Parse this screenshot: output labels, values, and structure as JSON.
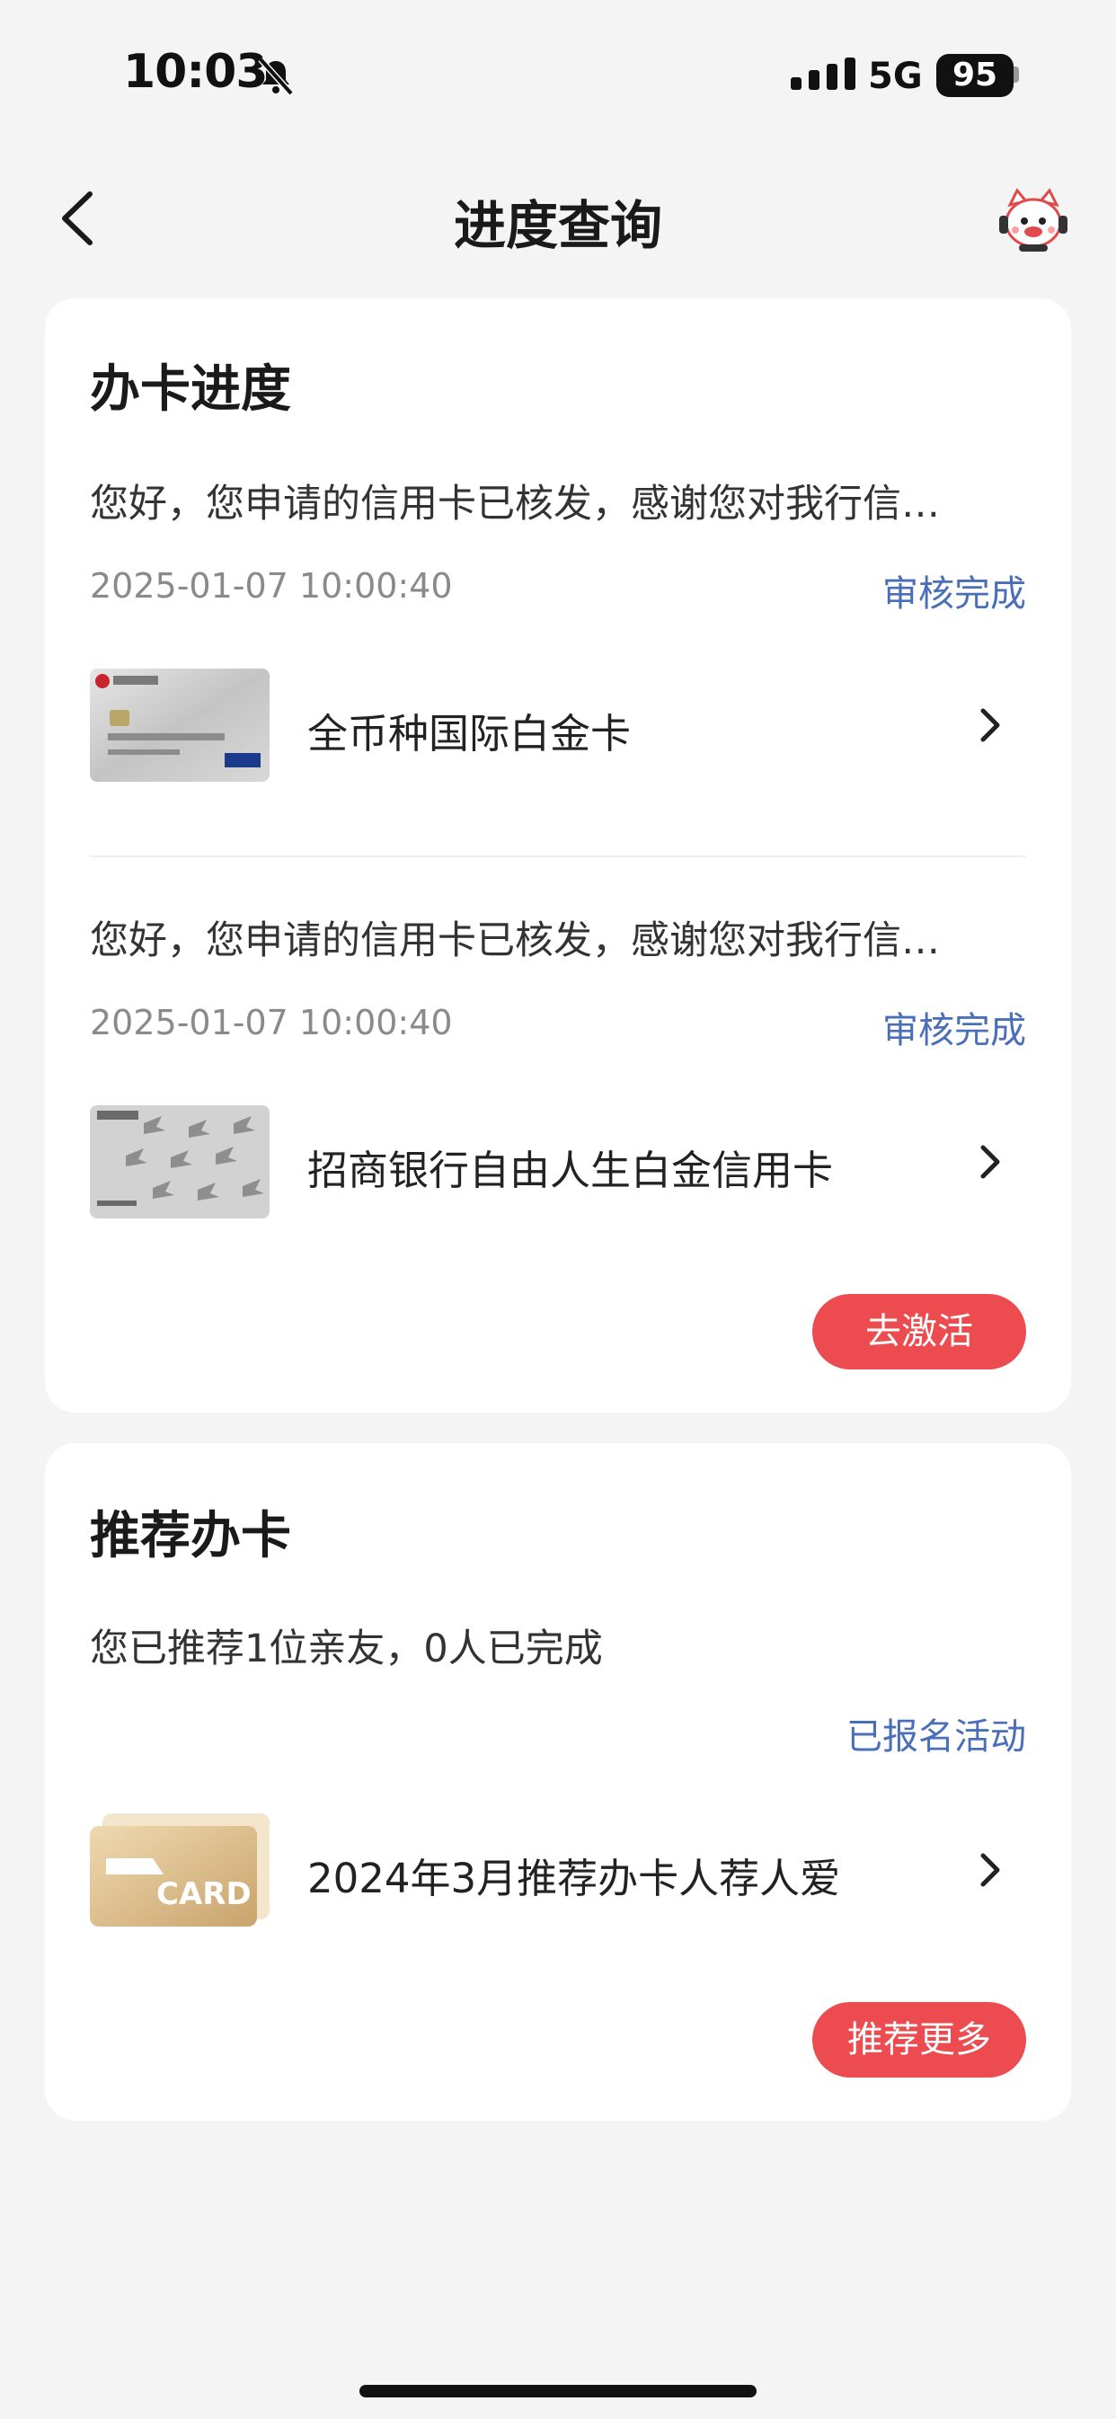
{
  "status_bar": {
    "time": "10:03",
    "network": "5G",
    "battery": "95"
  },
  "nav": {
    "title": "进度查询"
  },
  "progress": {
    "title": "办卡进度",
    "items": [
      {
        "message": "您好，您申请的信用卡已核发，感谢您对我行信…",
        "time": "2025-01-07 10:00:40",
        "status": "审核完成",
        "card_name": "全币种国际白金卡"
      },
      {
        "message": "您好，您申请的信用卡已核发，感谢您对我行信…",
        "time": "2025-01-07 10:00:40",
        "status": "审核完成",
        "card_name": "招商银行自由人生白金信用卡"
      }
    ],
    "activate_label": "去激活"
  },
  "recommend": {
    "title": "推荐办卡",
    "summary": "您已推荐1位亲友，0人已完成",
    "status": "已报名活动",
    "activity_name": "2024年3月推荐办卡人荐人爱",
    "more_label": "推荐更多",
    "thumb_text": "CARD"
  },
  "colors": {
    "accent": "#ec4b4f",
    "link": "#4a6fb8",
    "background": "#f4f4f4"
  }
}
